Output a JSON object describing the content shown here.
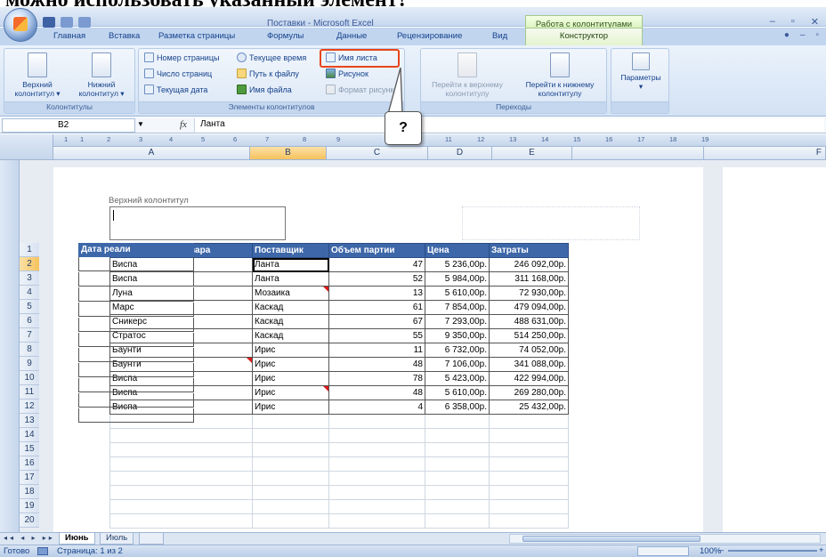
{
  "caption": "можно использовать указанный элемент?",
  "titlebar": {
    "app_title": "Поставки - Microsoft Excel",
    "context_title": "Работа с колонтитулами",
    "controls": [
      "–",
      "▫",
      "✕"
    ]
  },
  "tabs": [
    {
      "label": "Главная"
    },
    {
      "label": "Вставка"
    },
    {
      "label": "Разметка страницы"
    },
    {
      "label": "Формулы"
    },
    {
      "label": "Данные"
    },
    {
      "label": "Рецензирование"
    },
    {
      "label": "Вид"
    },
    {
      "label": "Конструктор",
      "active": true
    }
  ],
  "ribbon": {
    "group1": {
      "label": "Колонтитулы",
      "header_btn": "Верхний колонтитул ▾",
      "footer_btn": "Нижний колонтитул ▾"
    },
    "group2": {
      "label": "Элементы колонтитулов",
      "page_number": "Номер страницы",
      "page_count": "Число страниц",
      "current_date": "Текущая дата",
      "current_time": "Текущее время",
      "file_path": "Путь к файлу",
      "file_name": "Имя файла",
      "sheet_name": "Имя листа",
      "picture": "Рисунок",
      "format_picture": "Формат рисунка"
    },
    "group3": {
      "label": "Переходы",
      "goto_header": "Перейти к верхнему колонтитулу",
      "goto_footer": "Перейти к нижнему колонтитулу"
    },
    "group4": {
      "label": "",
      "params": "Параметры"
    }
  },
  "callout": "?",
  "formula_bar": {
    "name_box": "B2",
    "fx": "fx",
    "value": "Ланта"
  },
  "ruler": [
    "1",
    "1",
    "2",
    "3",
    "4",
    "5",
    "6",
    "7",
    "8",
    "9",
    "10",
    "11",
    "12",
    "13",
    "14",
    "15",
    "16",
    "17",
    "18",
    "19"
  ],
  "columns": [
    "A",
    "B",
    "C",
    "D",
    "E",
    "F"
  ],
  "selected_column": "B",
  "header_label": "Верхний колонтитул",
  "rows": [
    "1",
    "2",
    "3",
    "4",
    "5",
    "6",
    "7",
    "8",
    "9",
    "10",
    "11",
    "12",
    "13",
    "14",
    "15",
    "16",
    "17",
    "18",
    "19",
    "20"
  ],
  "table": {
    "headers": [
      "Наименование товара",
      "Поставщик",
      "Объем партии",
      "Цена",
      "Затраты"
    ],
    "rows": [
      [
        "Виспа",
        "Ланта",
        "47",
        "5 236,00р.",
        "246 092,00р."
      ],
      [
        "Виспа",
        "Ланта",
        "52",
        "5 984,00р.",
        "311 168,00р."
      ],
      [
        "Луна",
        "Мозаика",
        "13",
        "5 610,00р.",
        "72 930,00р."
      ],
      [
        "Марс",
        "Каскад",
        "61",
        "7 854,00р.",
        "479 094,00р."
      ],
      [
        "Сникерс",
        "Каскад",
        "67",
        "7 293,00р.",
        "488 631,00р."
      ],
      [
        "Стратос",
        "Каскад",
        "55",
        "9 350,00р.",
        "514 250,00р."
      ],
      [
        "Баунти",
        "Ирис",
        "11",
        "6 732,00р.",
        "74 052,00р."
      ],
      [
        "Баунти",
        "Ирис",
        "48",
        "7 106,00р.",
        "341 088,00р."
      ],
      [
        "Виспа",
        "Ирис",
        "78",
        "5 423,00р.",
        "422 994,00р."
      ],
      [
        "Виспа",
        "Ирис",
        "48",
        "5 610,00р.",
        "269 280,00р."
      ],
      [
        "Виспа",
        "Ирис",
        "4",
        "6 358,00р.",
        "25 432,00р."
      ]
    ]
  },
  "page2_header": "Дата реали",
  "sheet_tabs": [
    {
      "label": "Июнь",
      "active": true
    },
    {
      "label": "Июль"
    }
  ],
  "nav_buttons": "◂◂ ◂ ▸ ▸▸",
  "status": {
    "ready": "Готово",
    "page": "Страница: 1 из 2",
    "zoom": "100%",
    "zoom_minus": "–",
    "zoom_plus": "+"
  }
}
